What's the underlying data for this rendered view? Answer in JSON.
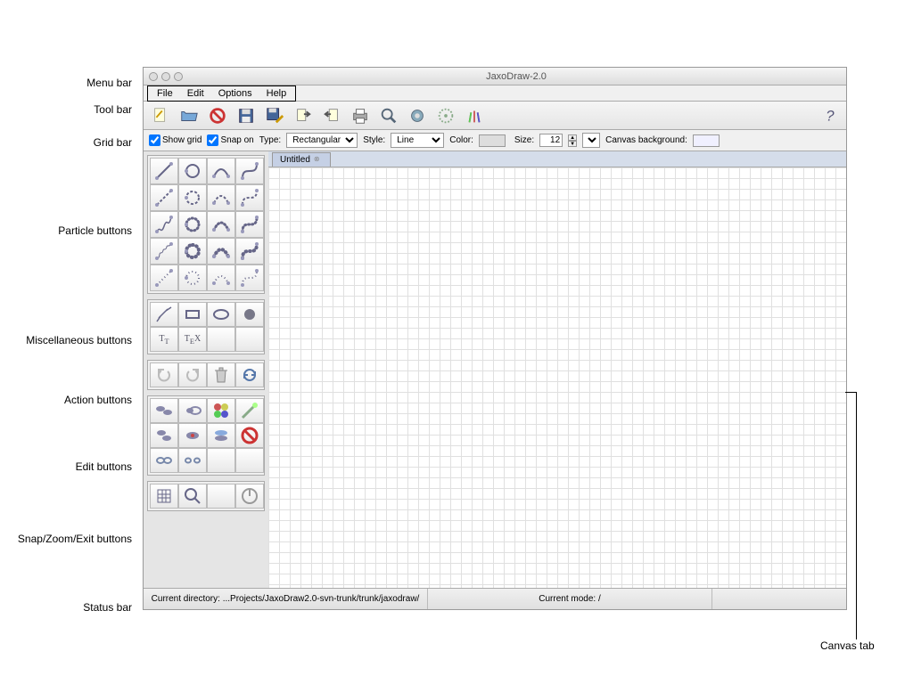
{
  "window": {
    "title": "JaxoDraw-2.0"
  },
  "menubar": {
    "items": [
      "File",
      "Edit",
      "Options",
      "Help"
    ]
  },
  "toolbar": {
    "buttons": [
      "new",
      "open",
      "close",
      "save",
      "saveas",
      "import",
      "export",
      "print",
      "preview",
      "watch",
      "prefs",
      "paste"
    ],
    "help": "help"
  },
  "gridbar": {
    "show_grid_label": "Show grid",
    "show_grid": true,
    "snap_on_label": "Snap on",
    "snap_on": true,
    "type_label": "Type:",
    "type_value": "Rectangular",
    "style_label": "Style:",
    "style_value": "Line",
    "color_label": "Color:",
    "size_label": "Size:",
    "size_value": "12",
    "bg_label": "Canvas background:"
  },
  "tab": {
    "label": "Untitled"
  },
  "statusbar": {
    "dir_label": "Current directory:",
    "dir_value": "...Projects/JaxoDraw2.0-svn-trunk/trunk/jaxodraw/",
    "mode_label": "Current mode:",
    "mode_value": "/"
  },
  "annotations": {
    "menubar": "Menu bar",
    "toolbar": "Tool bar",
    "gridbar": "Grid bar",
    "particle": "Particle buttons",
    "misc": "Miscellaneous buttons",
    "action": "Action buttons",
    "edit": "Edit buttons",
    "snapzoom": "Snap/Zoom/Exit buttons",
    "status": "Status bar",
    "canvas_tab": "Canvas tab"
  },
  "panels": {
    "particle_count": 20,
    "misc": [
      "zigzag",
      "box",
      "ellipse",
      "blob",
      "text",
      "latex",
      "empty1",
      "empty2"
    ],
    "action": [
      "undo",
      "redo",
      "trash",
      "refresh"
    ],
    "edit": [
      "move",
      "resize",
      "color",
      "edit",
      "copy",
      "duplicate",
      "fg",
      "delete",
      "group",
      "ungroup",
      "empty1",
      "empty2"
    ],
    "snapzoom": [
      "grid",
      "zoom",
      "empty",
      "exit"
    ]
  }
}
